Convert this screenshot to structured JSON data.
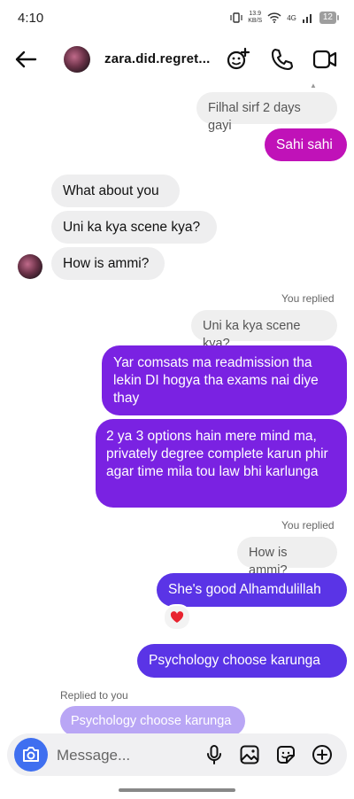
{
  "status_bar": {
    "time": "4:10",
    "net_speed_value": "13.9",
    "net_speed_unit": "KB/S",
    "network": "4G",
    "battery": "12"
  },
  "header": {
    "username": "zara.did.regret...",
    "back_icon": "arrow-left-icon",
    "icons": [
      "effects-icon",
      "phone-icon",
      "video-icon"
    ]
  },
  "messages": {
    "m1": "Filhal sirf 2 days gayi",
    "m2": "Sahi sahi",
    "m3": "What about you",
    "m4": "Uni ka kya scene kya?",
    "m5": "How is ammi?",
    "you_replied_1": "You replied",
    "m6_quote": "Uni ka kya scene kya?",
    "m7": "Yar comsats ma readmission tha lekin DI hogya tha exams nai diye thay",
    "m8": "2 ya 3 options hain mere mind ma, privately degree complete karun phir agar time mila tou law bhi karlunga",
    "you_replied_2": "You replied",
    "m9_quote": "How is ammi?",
    "m10": "She's good Alhamdulillah",
    "reaction": "❤️",
    "m11": "Psychology choose karunga",
    "replied_to_you": "Replied to you",
    "m12_quote": "Psychology choose karunga"
  },
  "composer": {
    "placeholder": "Message...",
    "icons": [
      "camera-icon",
      "microphone-icon",
      "gallery-icon",
      "sticker-icon",
      "plus-icon"
    ]
  },
  "colors": {
    "pink": "#c012b8",
    "purple": "#7a22e2",
    "violet": "#5a34e6",
    "incoming": "#eeeeef",
    "camera_blue": "#3f6ff0"
  }
}
